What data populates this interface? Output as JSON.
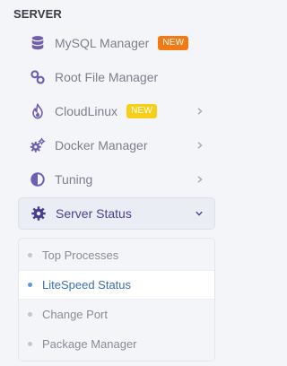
{
  "section": {
    "title": "SERVER"
  },
  "menu": {
    "items": [
      {
        "label": "MySQL Manager",
        "icon": "database-icon",
        "badge": "NEW",
        "badge_color": "#f07b14",
        "badge_text_color": "#ffffff",
        "chevron": false
      },
      {
        "label": "Root File Manager",
        "icon": "link-icon",
        "badge": null,
        "chevron": false
      },
      {
        "label": "CloudLinux",
        "icon": "flame-icon",
        "badge": "NEW",
        "badge_color": "#f7cf18",
        "badge_text_color": "#ffffff",
        "chevron": true
      },
      {
        "label": "Docker Manager",
        "icon": "gears-icon",
        "badge": null,
        "chevron": true
      },
      {
        "label": "Tuning",
        "icon": "half-circle-icon",
        "badge": null,
        "chevron": true
      },
      {
        "label": "Server Status",
        "icon": "gear-icon",
        "badge": null,
        "chevron": true,
        "expanded": true,
        "active": true
      }
    ]
  },
  "submenu": {
    "items": [
      {
        "label": "Top Processes",
        "active": false
      },
      {
        "label": "LiteSpeed Status",
        "active": true
      },
      {
        "label": "Change Port",
        "active": false
      },
      {
        "label": "Package Manager",
        "active": false
      }
    ]
  },
  "colors": {
    "icon": "#6f5fb0",
    "active_text": "#4a3f8f",
    "active_sub_text": "#3b6fb0",
    "chevron": "#a8a9b6",
    "chevron_active": "#4a3f8f"
  }
}
